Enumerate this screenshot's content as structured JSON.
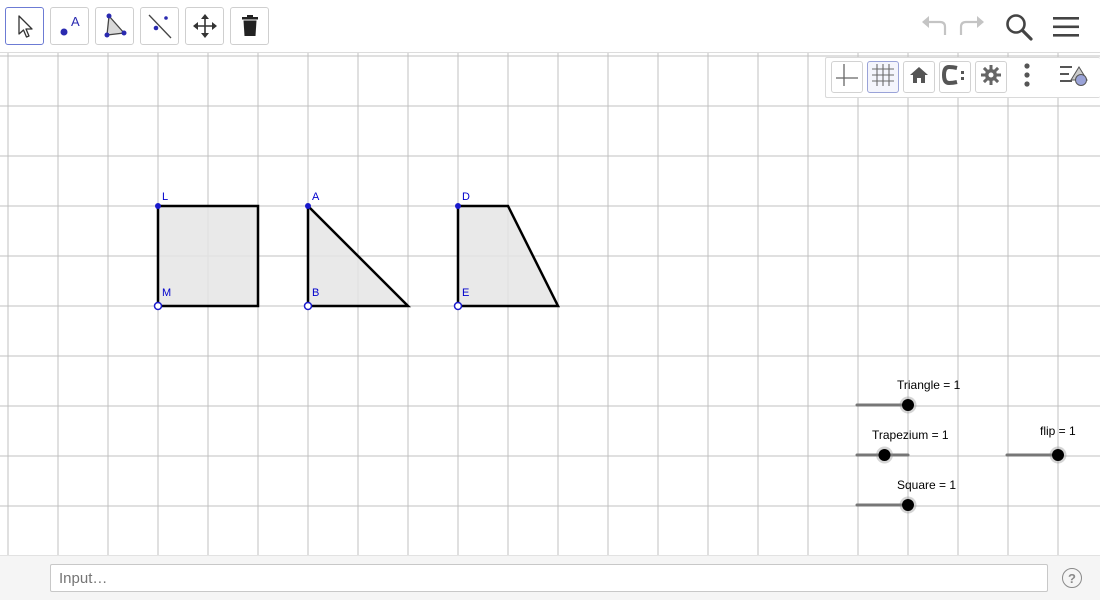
{
  "toolbar": {
    "tools": [
      {
        "name": "move-tool",
        "icon": "arrow-cursor-icon"
      },
      {
        "name": "point-tool",
        "icon": "point-a-icon",
        "label": "A"
      },
      {
        "name": "polygon-tool",
        "icon": "triangle-icon"
      },
      {
        "name": "line-tool",
        "icon": "line-through-points-icon"
      },
      {
        "name": "move-graphics-view-tool",
        "icon": "move-arrows-icon"
      },
      {
        "name": "delete-tool",
        "icon": "trash-icon"
      }
    ],
    "right": [
      "undo-icon",
      "redo-icon",
      "search-icon",
      "hamburger-menu-icon"
    ]
  },
  "stylebar": {
    "buttons": [
      "axes-icon",
      "grid-icon",
      "home-icon",
      "point-capture-icon",
      "gear-icon",
      "more-vertical-icon",
      "toggle-style-bar-icon"
    ],
    "selected": "grid-icon"
  },
  "points": {
    "L": "L",
    "M": "M",
    "A": "A",
    "B": "B",
    "D": "D",
    "E": "E"
  },
  "sliders": {
    "triangle": {
      "label": "Triangle = 1",
      "value": 1,
      "min": 0,
      "max": 1
    },
    "trapezium": {
      "label": "Trapezium = 1",
      "value": 1,
      "min": 0,
      "max": 2
    },
    "square": {
      "label": "Square = 1",
      "value": 1,
      "min": 0,
      "max": 1
    },
    "flip": {
      "label": "flip = 1",
      "value": 1,
      "min": 0,
      "max": 1
    }
  },
  "colors": {
    "grid": "#c0c0c0",
    "polygon_fill": "#e5e5e5",
    "point": "#1a1acc",
    "slider_track": "#777777"
  },
  "inputbar": {
    "placeholder": "Input…",
    "help": "?"
  }
}
